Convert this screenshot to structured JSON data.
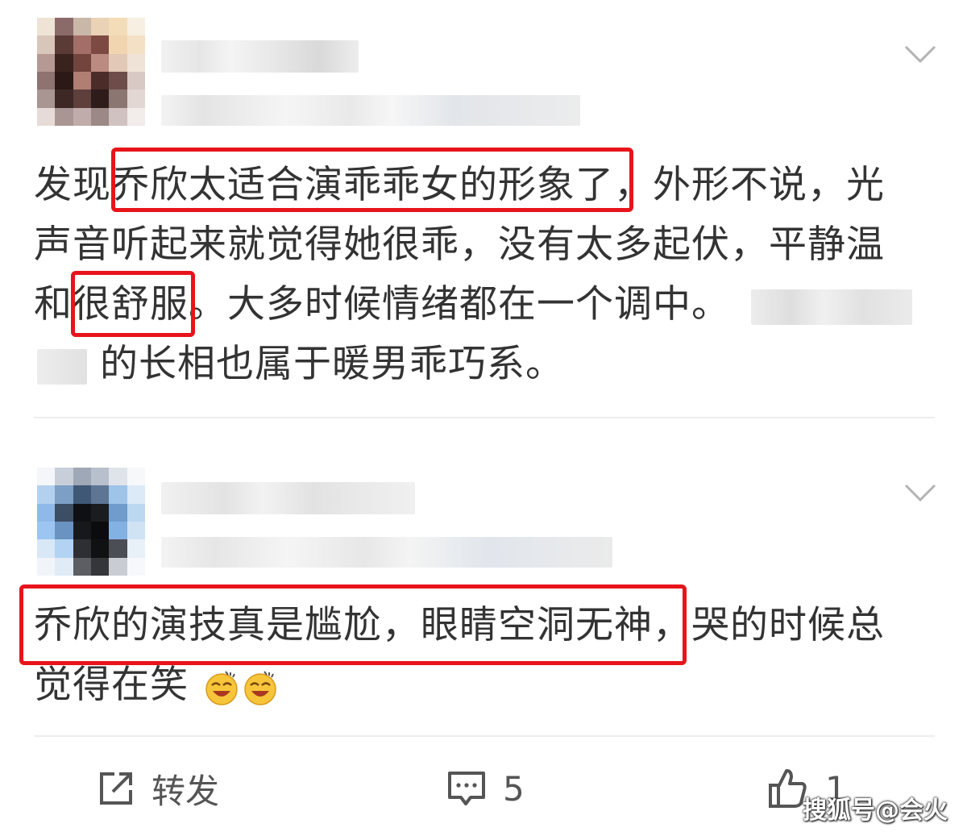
{
  "comments": [
    {
      "id": "comment-1",
      "lines": [
        "发现乔欣太适合演乖乖女的形象了，外形不说，光",
        "声音听起来就觉得她很乖，没有太多起伏，平静温",
        "和很舒服。大多时候情绪都在一个调中。",
        "的长相也属于暖男乖巧系。"
      ],
      "highlights": [
        "乔欣太适合演乖乖女的形象了",
        "很舒服"
      ]
    },
    {
      "id": "comment-2",
      "lines": [
        "乔欣的演技真是尴尬，眼睛空洞无神，哭的时候总",
        "觉得在笑"
      ],
      "highlights": [
        "乔欣的演技真是尴尬，眼睛空洞无神"
      ],
      "emojis": [
        "laugh-emoji",
        "laugh-emoji"
      ]
    }
  ],
  "toolbar": {
    "repost_label": "转发",
    "comment_count": "5",
    "like_count": "1"
  },
  "watermark": "搜狐号@会火",
  "colors": {
    "highlight": "#e8141b",
    "text": "#333333",
    "divider": "#ededed"
  }
}
